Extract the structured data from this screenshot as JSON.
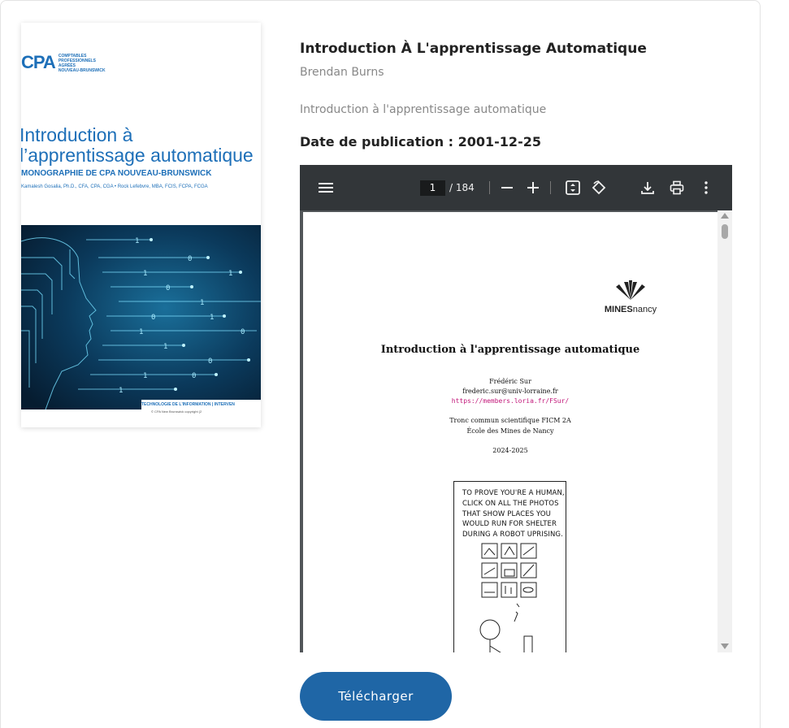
{
  "cover": {
    "logo_mark": "CPA",
    "logo_lines": [
      "COMPTABLES",
      "PROFESSIONNELS",
      "AGRÉÉS",
      "NOUVEAU-BRUNSWICK"
    ],
    "title_line1": "Introduction à",
    "title_line2": "l’apprentissage automatique",
    "subtitle": "MONOGRAPHIE DE CPA NOUVEAU-BRUNSWICK",
    "authors": "Kamalesh Gosalia, Ph.D., CFA, CPA, CGA • Rock Lefebvre, MBA, FCIS, FCPA, FCGA",
    "band_text": "TECHNOLOGIE DE L'INFORMATION | INTERVEN",
    "band_copy": "© CPA New Brunswick copyright (2"
  },
  "book": {
    "title": "Introduction À L'apprentissage Automatique",
    "author": "Brendan Burns",
    "description": "Introduction à l'apprentissage automatique",
    "pub_date_label": "Date de publication : 2001-12-25"
  },
  "viewer": {
    "page_current": "1",
    "page_total": "/ 184",
    "icons": {
      "menu": "menu-icon",
      "zoom_out": "minus-icon",
      "zoom_in": "plus-icon",
      "fit": "fit-page-icon",
      "rotate": "rotate-icon",
      "download": "download-icon",
      "print": "print-icon",
      "more": "more-vert-icon"
    },
    "page": {
      "logo_bold": "MINES",
      "logo_light": "nancy",
      "title": "Introduction à l'apprentissage automatique",
      "author": "Frédéric Sur",
      "email": "frederic.sur@univ-lorraine.fr",
      "url": "https://members.loria.fr/FSur/",
      "course": "Tronc commun scientifique FICM 2A",
      "school": "École des Mines de Nancy",
      "years": "2024-2025",
      "comic_text": "TO PROVE YOU'RE A HUMAN,\nCLICK ON ALL THE PHOTOS\nTHAT SHOW PLACES YOU\nWOULD RUN FOR SHELTER\nDURING A ROBOT UPRISING."
    }
  },
  "actions": {
    "download_label": "Télécharger"
  },
  "colors": {
    "accent": "#1f66a6",
    "cover_blue": "#1d6fb8",
    "viewer_toolbar": "#323639",
    "link_magenta": "#c2187a"
  }
}
